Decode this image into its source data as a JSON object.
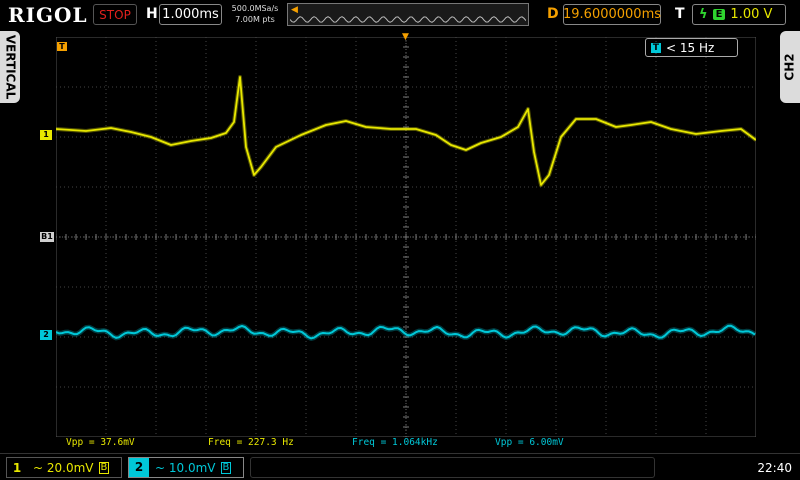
{
  "brand": "RIGOL",
  "top": {
    "state": "STOP",
    "h_label": "H",
    "timebase": "1.000ms",
    "sample_rate": "500.0MSa/s",
    "memory_depth": "7.00M pts",
    "d_label": "D",
    "delay": "19.6000000ms",
    "t_label": "T",
    "trigger_edge": "rising-edge-icon",
    "trigger_source": "E",
    "trigger_level": "1.00 V"
  },
  "tabs": {
    "left": "VERTICAL",
    "right": "CH2"
  },
  "markers": {
    "trigger": "T",
    "ch1": "1",
    "ch2": "2",
    "bus": "B1",
    "top_trigger": "▼"
  },
  "filter": {
    "icon": "T",
    "label": "< 15 Hz"
  },
  "measurements": [
    {
      "text": "Vpp = 37.6mV",
      "channel": 1
    },
    {
      "text": "Freq = 227.3 Hz",
      "channel": 1
    },
    {
      "text": "Freq = 1.064kHz",
      "channel": 2
    },
    {
      "text": "Vpp = 6.00mV",
      "channel": 2
    }
  ],
  "channels": [
    {
      "num": "1",
      "value": "~ 20.0mV",
      "bw_icon": "B",
      "color": "#e8e800"
    },
    {
      "num": "2",
      "value": "~ 10.0mV",
      "bw_icon": "B",
      "color": "#00c8d8"
    }
  ],
  "clock": "22:40",
  "colors": {
    "ch1": "#e8e800",
    "ch2": "#00c8d8",
    "trigger": "#f5a000",
    "stop": "#e0201c"
  }
}
